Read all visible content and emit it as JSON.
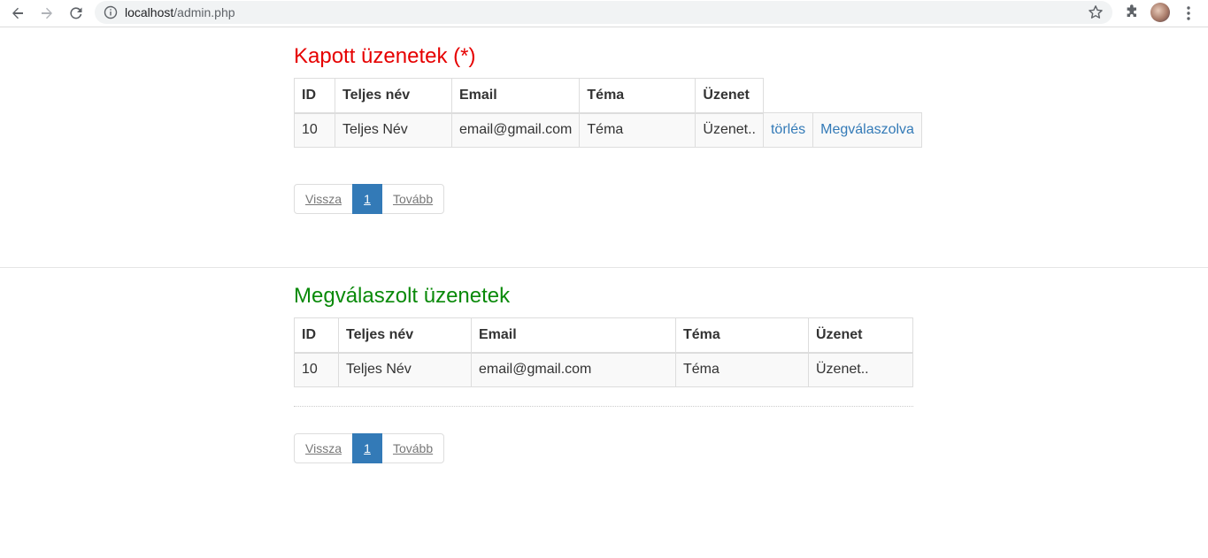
{
  "browser": {
    "url_host": "localhost",
    "url_path": "/admin.php",
    "icons": [
      "back-arrow-icon",
      "forward-arrow-icon",
      "reload-icon",
      "info-icon",
      "star-icon",
      "puzzle-extension-icon",
      "profile-avatar",
      "kebab-menu-icon"
    ]
  },
  "colors": {
    "received_title": "#e60000",
    "answered_title": "#0a8a0a",
    "link": "#337ab7",
    "pagination_active": "#337ab7"
  },
  "received": {
    "title": "Kapott üzenetek (*)",
    "headers": [
      "ID",
      "Teljes név",
      "Email",
      "Téma",
      "Üzenet"
    ],
    "rows": [
      {
        "id": "10",
        "name": "Teljes Név",
        "email": "email@gmail.com",
        "topic": "Téma",
        "message": "Üzenet..",
        "delete_link": "törlés",
        "answered_link": "Megválaszolva"
      }
    ],
    "pagination": {
      "prev": "Vissza",
      "current": "1",
      "next": "Tovább"
    }
  },
  "answered": {
    "title": "Megválaszolt üzenetek",
    "headers": [
      "ID",
      "Teljes név",
      "Email",
      "Téma",
      "Üzenet"
    ],
    "rows": [
      {
        "id": "10",
        "name": "Teljes Név",
        "email": "email@gmail.com",
        "topic": "Téma",
        "message": "Üzenet.."
      }
    ],
    "pagination": {
      "prev": "Vissza",
      "current": "1",
      "next": "Tovább"
    }
  }
}
